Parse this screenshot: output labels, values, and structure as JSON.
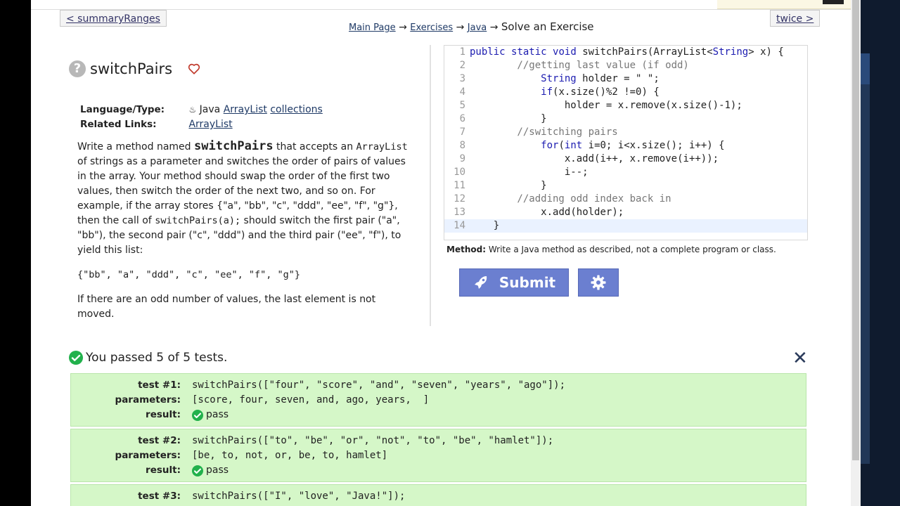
{
  "nav": {
    "prev": "< summaryRanges",
    "next": "twice >"
  },
  "breadcrumb": {
    "main": "Main Page",
    "exercises": "Exercises",
    "java": "Java",
    "current": "Solve an Exercise",
    "arrow": "→"
  },
  "problem": {
    "title": "switchPairs",
    "language_label": "Language/Type:",
    "language": "Java",
    "type1": "ArrayList",
    "type2": "collections",
    "related_label": "Related Links:",
    "related": "ArrayList"
  },
  "description": {
    "p1a": "Write a method named ",
    "p1b": "switchPairs",
    "p1c": " that accepts an ",
    "p1d": "ArrayList",
    "p1e": " of strings as a parameter and switches the order of pairs of values in the array. Your method should swap the order of the first two values, then switch the order of the next two, and so on. For example, if the array stores {\"a\", \"bb\", \"c\", \"ddd\", \"ee\", \"f\", \"g\"}, then the call of ",
    "p1f": "switchPairs(a);",
    "p1g": " should switch the first pair (\"a\", \"bb\"), the second pair (\"c\", \"ddd\") and the third pair (\"ee\", \"f\"), to yield this list:",
    "p2": "{\"bb\", \"a\", \"ddd\", \"c\", \"ee\", \"f\", \"g\"}",
    "p3": "If there are an odd number of values, the last element is not moved."
  },
  "code_lines": [
    "public static void switchPairs(ArrayList<String> x) {",
    "        //getting last value (if odd)",
    "            String holder = \" \";",
    "            if(x.size()%2 !=0) {",
    "                holder = x.remove(x.size()-1);",
    "            }",
    "        //switching pairs",
    "            for(int i=0; i<x.size(); i++) {",
    "                x.add(i++, x.remove(i++));",
    "                i--;",
    "            }",
    "        //adding odd index back in",
    "            x.add(holder);",
    "    }"
  ],
  "method_note": {
    "label": "Method:",
    "text": "Write a Java method as described, not a complete program or class."
  },
  "buttons": {
    "submit": "Submit"
  },
  "results": {
    "summary": "You passed 5 of 5 tests.",
    "close": "✕",
    "test_labels": {
      "test": "test #",
      "parameters": "parameters:",
      "result": "result:"
    },
    "tests": [
      {
        "label": "test #1:",
        "call": "switchPairs([\"four\", \"score\", \"and\", \"seven\", \"years\", \"ago\"]);",
        "params": "[score, four, seven, and, ago, years,  ]",
        "result": "pass"
      },
      {
        "label": "test #2:",
        "call": "switchPairs([\"to\", \"be\", \"or\", \"not\", \"to\", \"be\", \"hamlet\"]);",
        "params": "[be, to, not, or, be, to, hamlet]",
        "result": "pass"
      },
      {
        "label": "test #3:",
        "call": "switchPairs([\"I\", \"love\", \"Java!\"]);",
        "params": "",
        "result": ""
      }
    ]
  },
  "colors": {
    "submit_bg": "#6b7fd0",
    "pass_green": "#22b14c",
    "test_bg": "#d5f7c8"
  }
}
